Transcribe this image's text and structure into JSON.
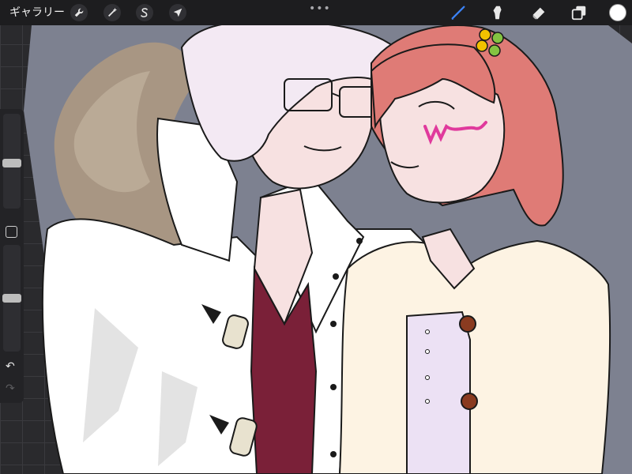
{
  "app": {
    "gallery_label": "ギャラリー",
    "menu_dots": "•••"
  },
  "toolbar": {
    "left_actions": [
      {
        "name": "actions-wrench-icon"
      },
      {
        "name": "adjustments-wand-icon"
      },
      {
        "name": "selection-s-icon"
      },
      {
        "name": "transform-arrow-icon"
      }
    ],
    "tools": [
      {
        "name": "brush-tool-icon",
        "active": true
      },
      {
        "name": "smudge-tool-icon",
        "active": false
      },
      {
        "name": "eraser-tool-icon",
        "active": false
      },
      {
        "name": "layers-icon",
        "active": false
      }
    ],
    "current_color": "#ffffff"
  },
  "sidebar": {
    "brush_size_level": 0.48,
    "opacity_level": 0.5,
    "undo_symbol": "↶",
    "redo_symbol": "↷"
  },
  "colors": {
    "active_tool": "#3b82f6",
    "canvas_background": "#7d8190",
    "man_hair": "#f3e9f3",
    "coat": "#ffffff",
    "coat_shadow": "#e3e3e3",
    "fur_collar": "#a89683",
    "shirt": "#7a2038",
    "skin": "#f7e1e1",
    "girl_hair": "#df7b76",
    "cardigan": "#fdf3e3",
    "blouse": "#ece1f4",
    "buttons": "#8a3b20",
    "face_mark": "#e0399c",
    "hair_clip": "#f2c200"
  }
}
